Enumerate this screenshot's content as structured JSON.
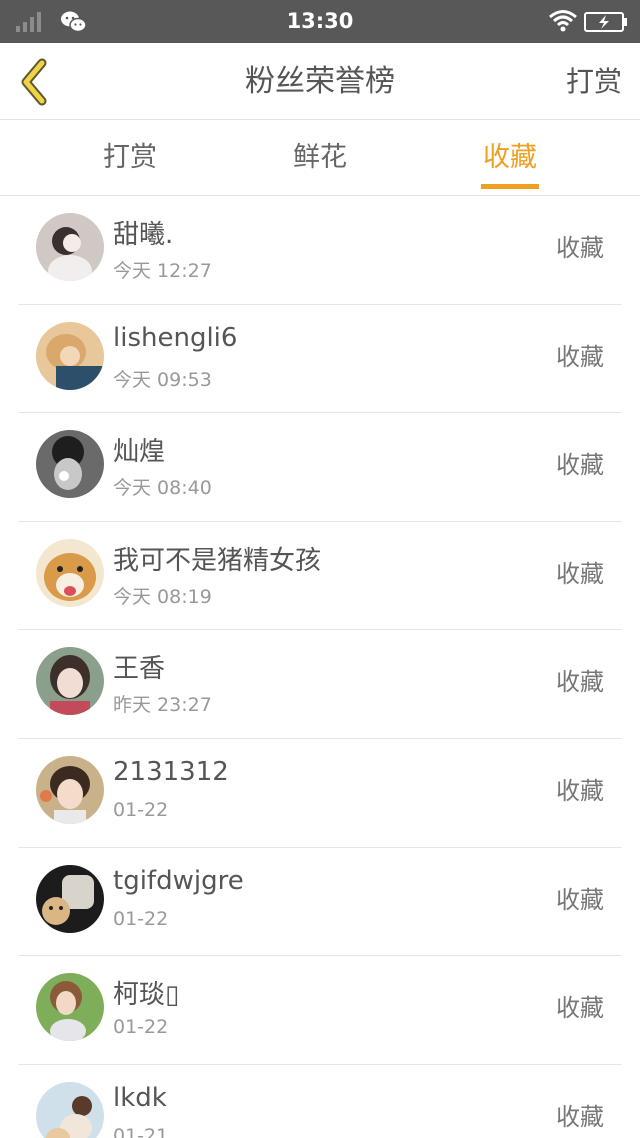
{
  "status_bar": {
    "time": "13:30"
  },
  "header": {
    "title": "粉丝荣誉榜",
    "right_label": "打赏"
  },
  "tabs": [
    {
      "label": "打赏",
      "active": false
    },
    {
      "label": "鲜花",
      "active": false
    },
    {
      "label": "收藏",
      "active": true
    }
  ],
  "colors": {
    "accent": "#f0a020",
    "status_bar": "#585858",
    "back_icon": "#f2d24a"
  },
  "list": [
    {
      "name": "甜曦.",
      "time": "今天 12:27",
      "action": "收藏"
    },
    {
      "name": "lishengli6",
      "time": "今天 09:53",
      "action": "收藏"
    },
    {
      "name": "灿煌",
      "time": "今天 08:40",
      "action": "收藏"
    },
    {
      "name": "我可不是猪精女孩",
      "time": "今天 08:19",
      "action": "收藏"
    },
    {
      "name": "王香",
      "time": "昨天 23:27",
      "action": "收藏"
    },
    {
      "name": "2131312",
      "time": "01-22",
      "action": "收藏"
    },
    {
      "name": "tgifdwjgre",
      "time": "01-22",
      "action": "收藏"
    },
    {
      "name": "柯琰▯",
      "time": "01-22",
      "action": "收藏"
    },
    {
      "name": "lkdk",
      "time": "01-21",
      "action": "收藏"
    }
  ]
}
